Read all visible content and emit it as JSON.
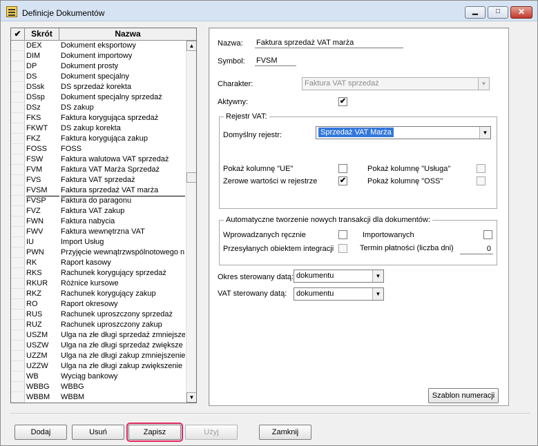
{
  "window": {
    "title": "Definicje Dokumentów",
    "min_glyph": "▁",
    "max_glyph": "□",
    "close_glyph": "✕"
  },
  "list": {
    "header_check": "✔",
    "header_skrot": "Skrót",
    "header_nazwa": "Nazwa",
    "rows": [
      {
        "skrot": "DEX",
        "nazwa": "Dokument eksportowy"
      },
      {
        "skrot": "DIM",
        "nazwa": "Dokument importowy"
      },
      {
        "skrot": "DP",
        "nazwa": "Dokument prosty"
      },
      {
        "skrot": "DS",
        "nazwa": "Dokument specjalny"
      },
      {
        "skrot": "DSsk",
        "nazwa": "DS sprzedaż korekta"
      },
      {
        "skrot": "DSsp",
        "nazwa": "Dokument specjalny sprzedaż"
      },
      {
        "skrot": "DSz",
        "nazwa": "DS zakup"
      },
      {
        "skrot": "FKS",
        "nazwa": "Faktura korygująca sprzedaż"
      },
      {
        "skrot": "FKWT",
        "nazwa": "DS zakup korekta"
      },
      {
        "skrot": "FKZ",
        "nazwa": "Faktura korygująca zakup"
      },
      {
        "skrot": "FOSS",
        "nazwa": "FOSS"
      },
      {
        "skrot": "FSW",
        "nazwa": "Faktura walutowa VAT sprzedaż"
      },
      {
        "skrot": "FVM",
        "nazwa": "Faktura VAT Marża Sprzedaż"
      },
      {
        "skrot": "FVS",
        "nazwa": "Faktura VAT sprzedaż"
      },
      {
        "skrot": "FVSM",
        "nazwa": "Faktura sprzedaż VAT marża"
      },
      {
        "skrot": "FVSP",
        "nazwa": "Faktura do paragonu"
      },
      {
        "skrot": "FVZ",
        "nazwa": "Faktura VAT zakup"
      },
      {
        "skrot": "FWN",
        "nazwa": "Faktura nabycia"
      },
      {
        "skrot": "FWV",
        "nazwa": "Faktura wewnętrzna VAT"
      },
      {
        "skrot": "IU",
        "nazwa": "Import Usług"
      },
      {
        "skrot": "PWN",
        "nazwa": "Przyjęcie wewnątrzwspólnotowego n"
      },
      {
        "skrot": "RK",
        "nazwa": "Raport kasowy"
      },
      {
        "skrot": "RKS",
        "nazwa": "Rachunek korygujący sprzedaż"
      },
      {
        "skrot": "RKUR",
        "nazwa": "Różnice kursowe"
      },
      {
        "skrot": "RKZ",
        "nazwa": "Rachunek korygujący zakup"
      },
      {
        "skrot": "RO",
        "nazwa": "Raport okresowy"
      },
      {
        "skrot": "RUS",
        "nazwa": "Rachunek uproszczony sprzedaż"
      },
      {
        "skrot": "RUZ",
        "nazwa": "Rachunek uproszczony zakup"
      },
      {
        "skrot": "USZM",
        "nazwa": "Ulga na złe długi sprzedaż zmniejsze"
      },
      {
        "skrot": "USZW",
        "nazwa": "Ulga na złe długi sprzedaż zwiększe"
      },
      {
        "skrot": "UZZM",
        "nazwa": "Ulga na złe długi zakup zmniejszenie"
      },
      {
        "skrot": "UZZW",
        "nazwa": "Ulga na złe długi zakup zwiększenie"
      },
      {
        "skrot": "WB",
        "nazwa": "Wyciąg bankowy"
      },
      {
        "skrot": "WBBG",
        "nazwa": "WBBG"
      },
      {
        "skrot": "WBBM",
        "nazwa": "WBBM"
      }
    ],
    "selected_skrot": "FVSM",
    "scroll_up_glyph": "▲",
    "scroll_down_glyph": "▼"
  },
  "form": {
    "nazwa_label": "Nazwa:",
    "nazwa_value": "Faktura sprzedaż VAT marża",
    "symbol_label": "Symbol:",
    "symbol_value": "FVSM",
    "charakter_label": "Charakter:",
    "charakter_value": "Faktura VAT sprzedaż",
    "aktywny_label": "Aktywny:",
    "aktywny_checked": "✔",
    "rejestr_group": "Rejestr VAT:",
    "domyslny_label": "Domyślny rejestr:",
    "domyslny_value": "Sprzedaż VAT Marża",
    "pokaz_ue_label": "Pokaż kolumnę \"UE\"",
    "pokaz_usluga_label": "Pokaż kolumnę \"Usługa\"",
    "zerowe_label": "Zerowe wartości w rejestrze",
    "zerowe_checked": "✔",
    "pokaz_oss_label": "Pokaż kolumnę \"OSS\"",
    "auto_group": "Automatyczne tworzenie nowych transakcji dla dokumentów:",
    "wprowadzanych_label": "Wprowadzanych ręcznie",
    "importowanych_label": "Importowanych",
    "przesylanych_label": "Przesyłanych obiektem integracji",
    "termin_label": "Termin płatności (liczba dni)",
    "termin_value": "0",
    "okres_label": "Okres sterowany datą:",
    "okres_value": "dokumentu",
    "vat_label": "VAT sterowany datą:",
    "vat_value": "dokumentu",
    "dropdown_glyph": "▼",
    "szablon_label": "Szablon numeracji"
  },
  "buttons": {
    "dodaj": "Dodaj",
    "usun": "Usuń",
    "zapisz": "Zapisz",
    "uzyj": "Użyj",
    "zamknij": "Zamknij"
  }
}
